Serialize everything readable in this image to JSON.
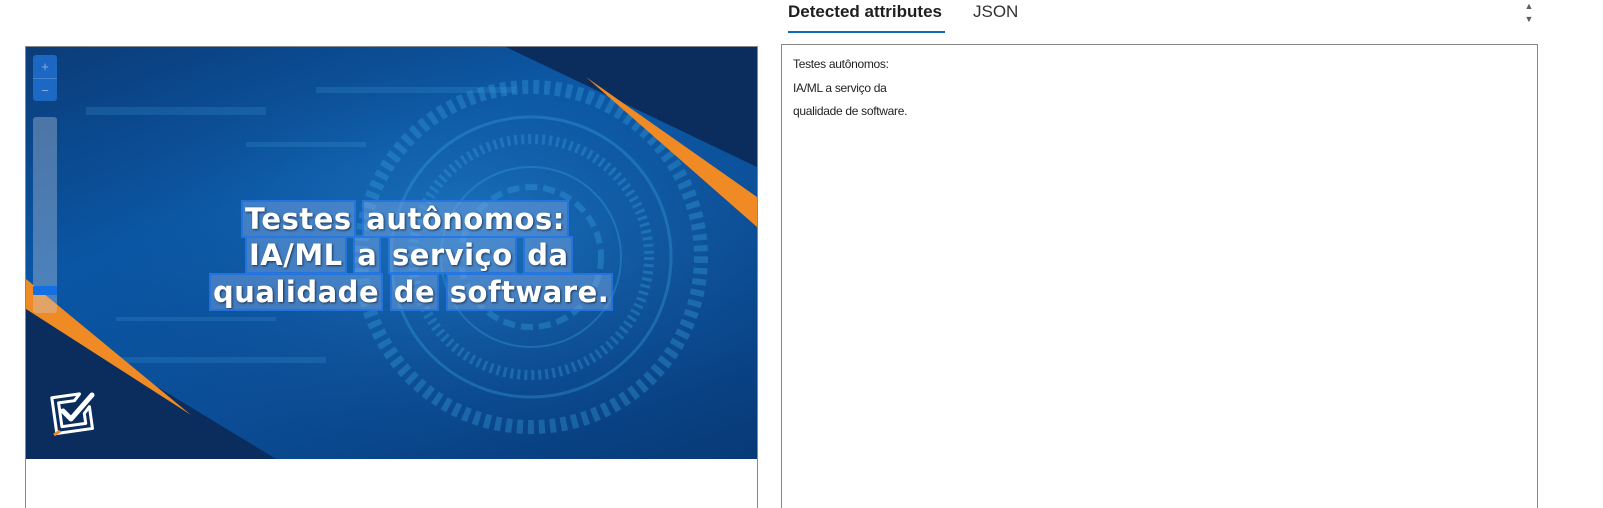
{
  "tabs": [
    {
      "label": "Detected attributes",
      "active": true
    },
    {
      "label": "JSON",
      "active": false
    }
  ],
  "image": {
    "ocr_lines": [
      [
        "Testes",
        "autônomos:"
      ],
      [
        "IA/ML",
        "a",
        "serviço",
        "da"
      ],
      [
        "qualidade",
        "de",
        "software."
      ]
    ]
  },
  "zoom": {
    "in_label": "+",
    "out_label": "−"
  },
  "results": {
    "lines": [
      "Testes autônomos:",
      "IA/ML a serviço da",
      "qualidade de software."
    ]
  },
  "scroll": {
    "up": "▲",
    "down": "▼"
  },
  "colors": {
    "accent": "#0f6cbd",
    "image_blue": "#0a57a6",
    "orange": "#f08a24",
    "word_highlight": "#2878e6"
  },
  "icons": [
    "checkbox-logo-icon",
    "scroll-up-icon",
    "scroll-down-icon",
    "zoom-in-icon",
    "zoom-out-icon"
  ]
}
